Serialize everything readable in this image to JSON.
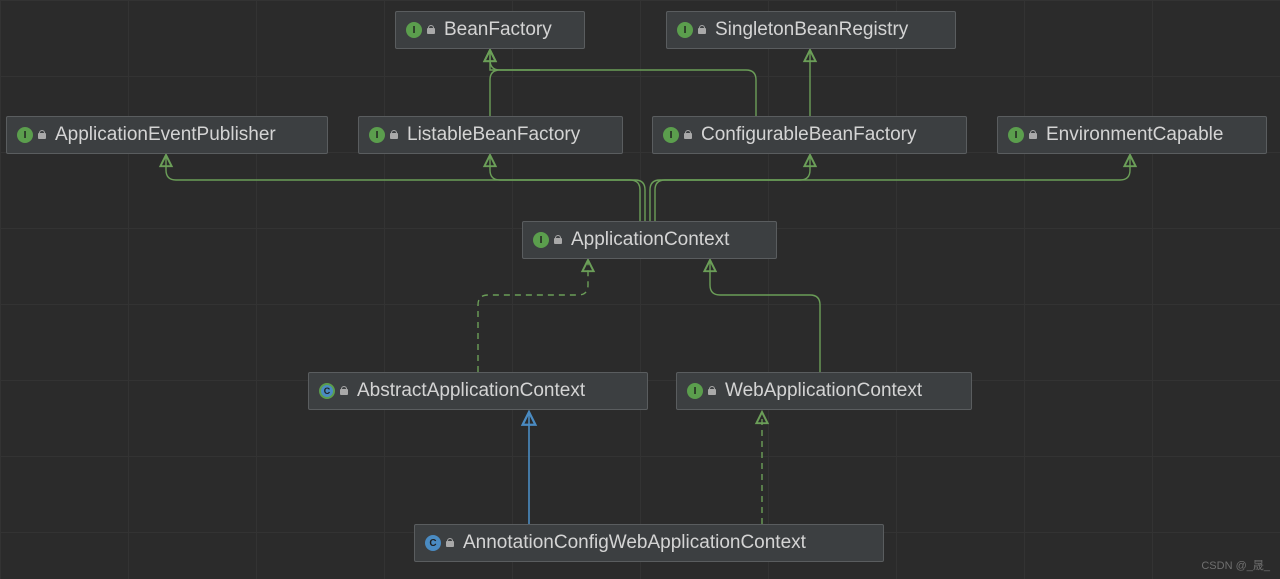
{
  "nodes": {
    "beanFactory": {
      "label": "BeanFactory",
      "type": "interface"
    },
    "singletonBeanRegistry": {
      "label": "SingletonBeanRegistry",
      "type": "interface"
    },
    "appEventPublisher": {
      "label": "ApplicationEventPublisher",
      "type": "interface"
    },
    "listableBeanFactory": {
      "label": "ListableBeanFactory",
      "type": "interface"
    },
    "configurableBeanFactory": {
      "label": "ConfigurableBeanFactory",
      "type": "interface"
    },
    "environmentCapable": {
      "label": "EnvironmentCapable",
      "type": "interface"
    },
    "applicationContext": {
      "label": "ApplicationContext",
      "type": "interface"
    },
    "abstractAppContext": {
      "label": "AbstractApplicationContext",
      "type": "abstract"
    },
    "webAppContext": {
      "label": "WebApplicationContext",
      "type": "interface"
    },
    "annotationCfgWebAppCtx": {
      "label": "AnnotationConfigWebApplicationContext",
      "type": "class"
    }
  },
  "edges": [
    {
      "from": "listableBeanFactory",
      "to": "beanFactory",
      "kind": "extends-interface"
    },
    {
      "from": "configurableBeanFactory",
      "to": "beanFactory",
      "kind": "extends-interface"
    },
    {
      "from": "configurableBeanFactory",
      "to": "singletonBeanRegistry",
      "kind": "extends-interface"
    },
    {
      "from": "applicationContext",
      "to": "appEventPublisher",
      "kind": "extends-interface"
    },
    {
      "from": "applicationContext",
      "to": "listableBeanFactory",
      "kind": "extends-interface"
    },
    {
      "from": "applicationContext",
      "to": "configurableBeanFactory",
      "kind": "extends-interface"
    },
    {
      "from": "applicationContext",
      "to": "environmentCapable",
      "kind": "extends-interface"
    },
    {
      "from": "abstractAppContext",
      "to": "applicationContext",
      "kind": "implements"
    },
    {
      "from": "webAppContext",
      "to": "applicationContext",
      "kind": "extends-interface"
    },
    {
      "from": "annotationCfgWebAppCtx",
      "to": "abstractAppContext",
      "kind": "extends-class"
    },
    {
      "from": "annotationCfgWebAppCtx",
      "to": "webAppContext",
      "kind": "implements"
    }
  ],
  "watermark": "CSDN @_晟_"
}
